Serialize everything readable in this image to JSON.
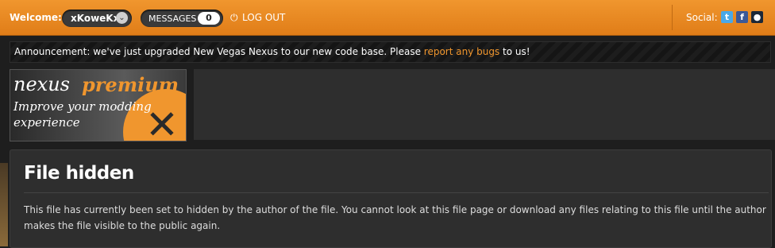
{
  "topbar": {
    "welcome_label": "Welcome:",
    "username": "xKoweKx",
    "messages_label": "MESSAGES",
    "messages_count": "0",
    "logout_label": "LOG OUT",
    "social_label": "Social:",
    "social_icons": [
      "twitter-icon",
      "facebook-icon",
      "steam-icon"
    ]
  },
  "announcement": {
    "prefix": "Announcement: we've just upgraded New Vegas Nexus to our new code base. Please ",
    "link": "report any bugs",
    "suffix": " to us!"
  },
  "banner": {
    "brand1": "nexus",
    "brand2": "premium",
    "tagline1": "Improve your modding",
    "tagline2": "experience"
  },
  "main": {
    "title": "File hidden",
    "body": "This file has currently been set to hidden by the author of the file. You cannot look at this file page or download any files relating to this file until the author makes the file visible to the public again."
  },
  "colors": {
    "accent": "#e88a24",
    "panel": "#2e2e2e",
    "background": "#1e1e1e"
  }
}
